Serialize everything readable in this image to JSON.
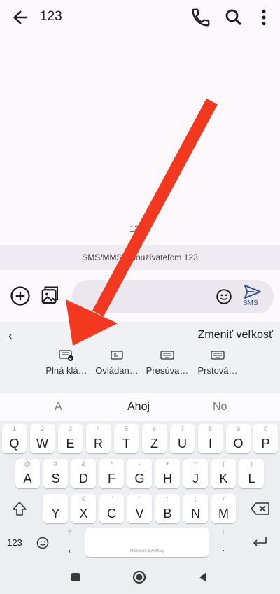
{
  "header": {
    "title": "123"
  },
  "conversation": {
    "timestamp": "12:53",
    "info": "SMS/MMS s používateľom 123"
  },
  "composer": {
    "send_label": "SMS"
  },
  "keyboard_resize": {
    "title": "Zmeniť veľkosť",
    "options": [
      "Plná klá…",
      "Ovládan…",
      "Presúva…",
      "Prstová…"
    ]
  },
  "suggestions": [
    "A",
    "Ahoj",
    "No"
  ],
  "keys": {
    "row1": [
      {
        "main": "Q",
        "hint": "1"
      },
      {
        "main": "W",
        "hint": "2"
      },
      {
        "main": "E",
        "hint": "3"
      },
      {
        "main": "R",
        "hint": "4"
      },
      {
        "main": "T",
        "hint": "5"
      },
      {
        "main": "Z",
        "hint": "6"
      },
      {
        "main": "U",
        "hint": "7"
      },
      {
        "main": "I",
        "hint": "8"
      },
      {
        "main": "O",
        "hint": "9"
      },
      {
        "main": "P",
        "hint": "0"
      }
    ],
    "row2": [
      {
        "main": "A",
        "hint": "@"
      },
      {
        "main": "S",
        "hint": "#"
      },
      {
        "main": "D",
        "hint": "&"
      },
      {
        "main": "F",
        "hint": "*"
      },
      {
        "main": "G",
        "hint": "-"
      },
      {
        "main": "H",
        "hint": "+"
      },
      {
        "main": "J",
        "hint": "="
      },
      {
        "main": "K",
        "hint": "("
      },
      {
        "main": "L",
        "hint": ")"
      }
    ],
    "row3": [
      {
        "main": "Y",
        "hint": "_"
      },
      {
        "main": "X",
        "hint": "€"
      },
      {
        "main": "C",
        "hint": "\""
      },
      {
        "main": "V",
        "hint": "'"
      },
      {
        "main": "B",
        "hint": ":"
      },
      {
        "main": "N",
        "hint": ";"
      },
      {
        "main": "M",
        "hint": "/"
      }
    ],
    "numbers_label": "123",
    "comma_hint": "?",
    "comma": ",",
    "period_hint": "!",
    "period": ".",
    "space_label": "Microsoft SwiftKey"
  },
  "colors": {
    "accent": "#2f4f86",
    "arrow": "#f2381f"
  }
}
